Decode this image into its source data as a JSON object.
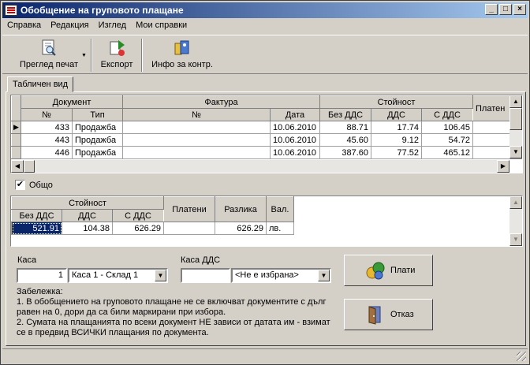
{
  "window": {
    "title": "Обобщение на груповото плащане"
  },
  "menu": [
    "Справка",
    "Редакция",
    "Изглед",
    "Мои справки"
  ],
  "toolbar": {
    "preview": "Преглед печат",
    "export": "Експорт",
    "info": "Инфо за контр."
  },
  "tab": "Табличен вид",
  "docs_grid": {
    "groups": {
      "document": "Документ",
      "invoice": "Фактура",
      "value": "Стойност",
      "paid": "Платен"
    },
    "cols": {
      "no": "№",
      "type": "Тип",
      "inv_no": "№",
      "date": "Дата",
      "no_vat": "Без ДДС",
      "vat": "ДДС",
      "with_vat": "С ДДС"
    },
    "rows": [
      {
        "no": "433",
        "type": "Продажба",
        "inv_no": "",
        "date": "10.06.2010",
        "no_vat": "88.71",
        "vat": "17.74",
        "with_vat": "106.45"
      },
      {
        "no": "443",
        "type": "Продажба",
        "inv_no": "",
        "date": "10.06.2010",
        "no_vat": "45.60",
        "vat": "9.12",
        "with_vat": "54.72"
      },
      {
        "no": "446",
        "type": "Продажба",
        "inv_no": "",
        "date": "10.06.2010",
        "no_vat": "387.60",
        "vat": "77.52",
        "with_vat": "465.12"
      }
    ]
  },
  "total_checkbox": {
    "label": "Общо",
    "checked": "✔"
  },
  "totals_grid": {
    "group_value": "Стойност",
    "cols": {
      "no_vat": "Без ДДС",
      "vat": "ДДС",
      "with_vat": "С ДДС",
      "paid": "Платени",
      "diff": "Разлика",
      "cur": "Вал."
    },
    "row": {
      "no_vat": "521.91",
      "vat": "104.38",
      "with_vat": "626.29",
      "paid": "",
      "diff": "626.29",
      "cur": "лв."
    }
  },
  "cash": {
    "label": "Каса",
    "value": "1",
    "select": "Каса 1 - Склад 1"
  },
  "cash_vat": {
    "label": "Каса ДДС",
    "value": "",
    "select": "<Не е избрана>"
  },
  "buttons": {
    "pay": "Плати",
    "cancel": "Отказ"
  },
  "note": {
    "title": "Забележка:",
    "line1": "1. В обобщението на груповото плащане не се включват документите с дълг равен на 0, дори да са били маркирани при избора.",
    "line2": "2. Сумата на плащанията по всеки документ НЕ зависи от датата им - взимат се в предвид ВСИЧКИ плащания по документа."
  }
}
